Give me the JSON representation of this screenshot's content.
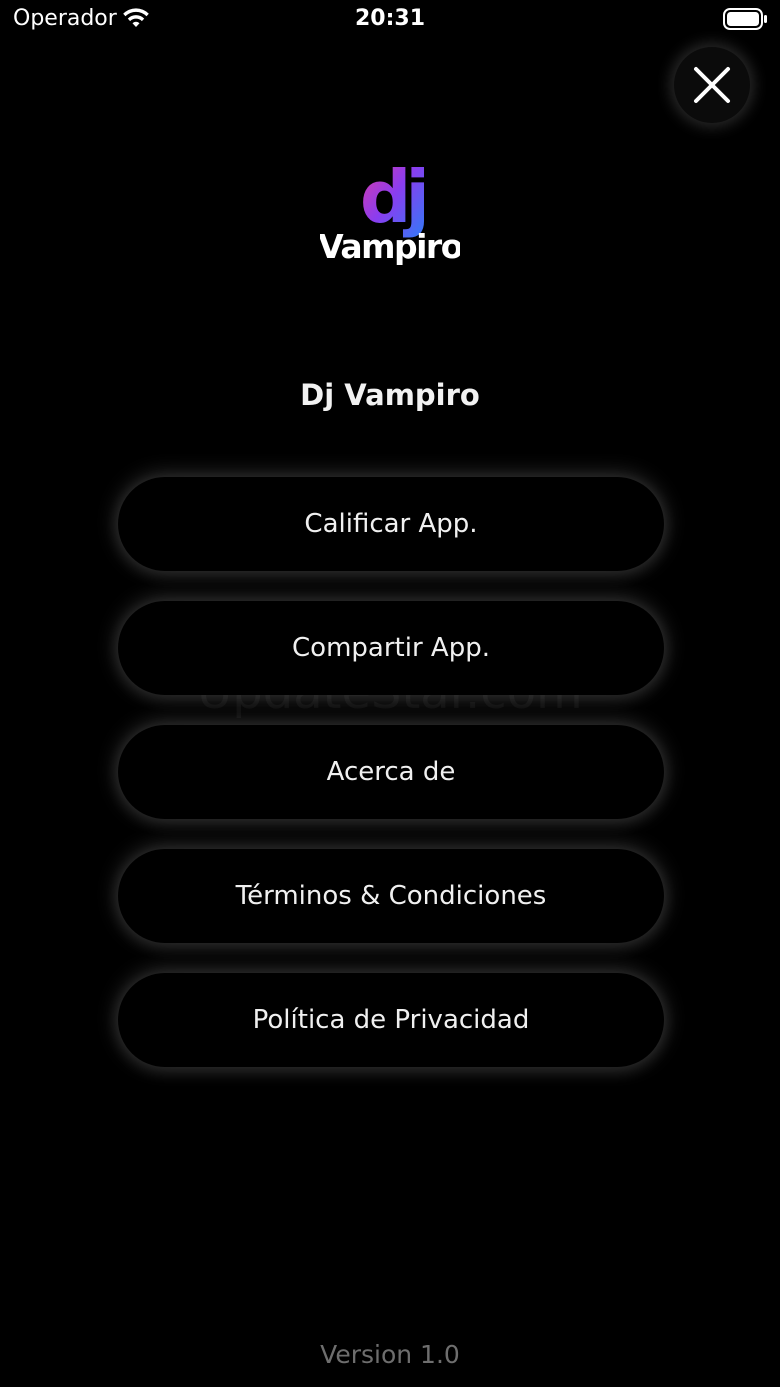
{
  "status_bar": {
    "carrier": "Operador",
    "time": "20:31",
    "wifi_icon": "wifi-icon",
    "battery_icon": "battery-full-icon"
  },
  "close_icon": "close-icon",
  "logo": {
    "mark": "dj",
    "word": "Vampiro",
    "colors": {
      "gradient_start": "#e83a9b",
      "gradient_mid": "#8a3df0",
      "gradient_end": "#2f7bf7"
    }
  },
  "app_name": "Dj Vampiro",
  "menu": {
    "items": [
      {
        "label": "Calificar App."
      },
      {
        "label": "Compartir App."
      },
      {
        "label": "Acerca de"
      },
      {
        "label": "Términos & Condiciones"
      },
      {
        "label": "Política de Privacidad"
      }
    ]
  },
  "watermark": "UpdateStar.com",
  "version": "Version 1.0"
}
